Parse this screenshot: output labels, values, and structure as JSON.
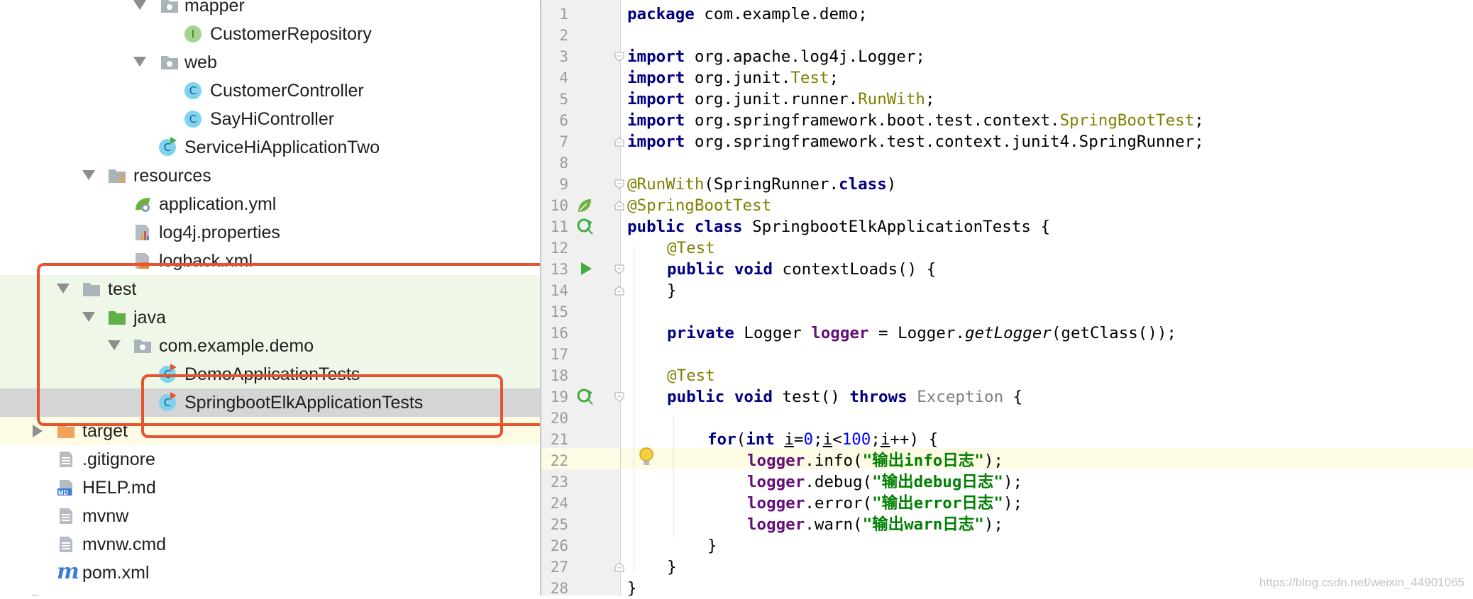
{
  "tree": {
    "items": [
      {
        "label": "mapper"
      },
      {
        "label": "CustomerRepository",
        "badge": "I"
      },
      {
        "label": "web"
      },
      {
        "label": "CustomerController",
        "badge": "C"
      },
      {
        "label": "SayHiController",
        "badge": "C"
      },
      {
        "label": "ServiceHiApplicationTwo",
        "badge": "C"
      },
      {
        "label": "resources"
      },
      {
        "label": "application.yml"
      },
      {
        "label": "log4j.properties"
      },
      {
        "label": "logback.xml"
      },
      {
        "label": "test"
      },
      {
        "label": "java"
      },
      {
        "label": "com.example.demo"
      },
      {
        "label": "DemoApplicationTests",
        "badge": "C"
      },
      {
        "label": "SpringbootElkApplicationTests",
        "badge": "C"
      },
      {
        "label": "target"
      },
      {
        "label": ".gitignore"
      },
      {
        "label": "HELP.md",
        "badge": "MD"
      },
      {
        "label": "mvnw"
      },
      {
        "label": "mvnw.cmd"
      },
      {
        "label": "pom.xml",
        "badge": "m"
      }
    ]
  },
  "editor": {
    "line_numbers": [
      "1",
      "2",
      "3",
      "4",
      "5",
      "6",
      "7",
      "8",
      "9",
      "10",
      "11",
      "12",
      "13",
      "14",
      "15",
      "16",
      "17",
      "18",
      "19",
      "20",
      "21",
      "22",
      "23",
      "24",
      "25",
      "26",
      "27",
      "28"
    ],
    "code": {
      "l1_kw": "package",
      "l1_rest": " com.example.demo;",
      "l3_kw": "import",
      "l3_rest": " org.apache.log4j.Logger;",
      "l4_kw": "import",
      "l4_a": " org.junit.",
      "l4_ann": "Test",
      "l4_b": ";",
      "l5_kw": "import",
      "l5_a": " org.junit.runner.",
      "l5_ann": "RunWith",
      "l5_b": ";",
      "l6_kw": "import",
      "l6_a": " org.springframework.boot.test.context.",
      "l6_ann": "SpringBootTest",
      "l6_b": ";",
      "l7_kw": "import",
      "l7_rest": " org.springframework.test.context.junit4.SpringRunner;",
      "l9_ann": "@RunWith",
      "l9_a": "(SpringRunner.",
      "l9_kw": "class",
      "l9_b": ")",
      "l10_ann": "@SpringBootTest",
      "l11_kw": "public class",
      "l11_rest": " SpringbootElkApplicationTests {",
      "l12_ann": "@Test",
      "l13_kw": "public void",
      "l13_rest": " contextLoads() {",
      "l14": "}",
      "l16_kw": "private",
      "l16_a": " Logger ",
      "l16_fld": "logger",
      "l16_b": " = Logger.",
      "l16_it": "getLogger",
      "l16_c": "(getClass());",
      "l18_ann": "@Test",
      "l19_kw": "public void",
      "l19_a": " test() ",
      "l19_kw2": "throws",
      "l19_gray": " Exception",
      "l19_b": " {",
      "l21_kw": "for",
      "l21_a": "(",
      "l21_kw2": "int",
      "l21_b": " ",
      "l21_i1": "i",
      "l21_c": "=",
      "l21_n0": "0",
      "l21_d": ";",
      "l21_i2": "i",
      "l21_e": "<",
      "l21_n100": "100",
      "l21_f": ";",
      "l21_i3": "i",
      "l21_g": "++) {",
      "l22_fld": "logger",
      "l22_a": ".info(",
      "l22_str": "\"输出info日志\"",
      "l22_b": ");",
      "l23_fld": "logger",
      "l23_a": ".debug(",
      "l23_str": "\"输出debug日志\"",
      "l23_b": ");",
      "l24_fld": "logger",
      "l24_a": ".error(",
      "l24_str": "\"输出error日志\"",
      "l24_b": ");",
      "l25_fld": "logger",
      "l25_a": ".warn(",
      "l25_str": "\"输出warn日志\"",
      "l25_b": ");",
      "l26": "}",
      "l27": "}",
      "l28": "}"
    }
  },
  "watermark": "https://blog.csdn.net/weixin_44901065",
  "colors": {
    "highlight_box": "#e8532f",
    "keyword": "#000080",
    "annotation": "#808000",
    "string": "#008000"
  }
}
